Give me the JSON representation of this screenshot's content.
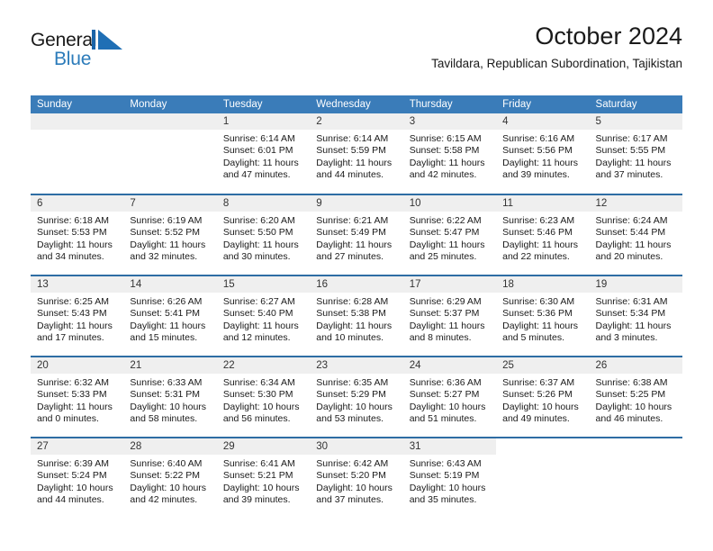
{
  "brand": {
    "name_part1": "General",
    "name_part2": "Blue",
    "mark": "triangle-logo"
  },
  "header": {
    "title": "October 2024",
    "subtitle": "Tavildara, Republican Subordination, Tajikistan"
  },
  "colors": {
    "header_blue": "#3a7cb9",
    "row_border_blue": "#2e6da4",
    "daynum_strip": "#efefef",
    "brand_blue": "#2b7bba"
  },
  "weekday_headers": [
    "Sunday",
    "Monday",
    "Tuesday",
    "Wednesday",
    "Thursday",
    "Friday",
    "Saturday"
  ],
  "weeks": [
    [
      {
        "day": "",
        "empty": true
      },
      {
        "day": "",
        "empty": true
      },
      {
        "day": "1",
        "sunrise": "Sunrise: 6:14 AM",
        "sunset": "Sunset: 6:01 PM",
        "daylight1": "Daylight: 11 hours",
        "daylight2": "and 47 minutes."
      },
      {
        "day": "2",
        "sunrise": "Sunrise: 6:14 AM",
        "sunset": "Sunset: 5:59 PM",
        "daylight1": "Daylight: 11 hours",
        "daylight2": "and 44 minutes."
      },
      {
        "day": "3",
        "sunrise": "Sunrise: 6:15 AM",
        "sunset": "Sunset: 5:58 PM",
        "daylight1": "Daylight: 11 hours",
        "daylight2": "and 42 minutes."
      },
      {
        "day": "4",
        "sunrise": "Sunrise: 6:16 AM",
        "sunset": "Sunset: 5:56 PM",
        "daylight1": "Daylight: 11 hours",
        "daylight2": "and 39 minutes."
      },
      {
        "day": "5",
        "sunrise": "Sunrise: 6:17 AM",
        "sunset": "Sunset: 5:55 PM",
        "daylight1": "Daylight: 11 hours",
        "daylight2": "and 37 minutes."
      }
    ],
    [
      {
        "day": "6",
        "sunrise": "Sunrise: 6:18 AM",
        "sunset": "Sunset: 5:53 PM",
        "daylight1": "Daylight: 11 hours",
        "daylight2": "and 34 minutes."
      },
      {
        "day": "7",
        "sunrise": "Sunrise: 6:19 AM",
        "sunset": "Sunset: 5:52 PM",
        "daylight1": "Daylight: 11 hours",
        "daylight2": "and 32 minutes."
      },
      {
        "day": "8",
        "sunrise": "Sunrise: 6:20 AM",
        "sunset": "Sunset: 5:50 PM",
        "daylight1": "Daylight: 11 hours",
        "daylight2": "and 30 minutes."
      },
      {
        "day": "9",
        "sunrise": "Sunrise: 6:21 AM",
        "sunset": "Sunset: 5:49 PM",
        "daylight1": "Daylight: 11 hours",
        "daylight2": "and 27 minutes."
      },
      {
        "day": "10",
        "sunrise": "Sunrise: 6:22 AM",
        "sunset": "Sunset: 5:47 PM",
        "daylight1": "Daylight: 11 hours",
        "daylight2": "and 25 minutes."
      },
      {
        "day": "11",
        "sunrise": "Sunrise: 6:23 AM",
        "sunset": "Sunset: 5:46 PM",
        "daylight1": "Daylight: 11 hours",
        "daylight2": "and 22 minutes."
      },
      {
        "day": "12",
        "sunrise": "Sunrise: 6:24 AM",
        "sunset": "Sunset: 5:44 PM",
        "daylight1": "Daylight: 11 hours",
        "daylight2": "and 20 minutes."
      }
    ],
    [
      {
        "day": "13",
        "sunrise": "Sunrise: 6:25 AM",
        "sunset": "Sunset: 5:43 PM",
        "daylight1": "Daylight: 11 hours",
        "daylight2": "and 17 minutes."
      },
      {
        "day": "14",
        "sunrise": "Sunrise: 6:26 AM",
        "sunset": "Sunset: 5:41 PM",
        "daylight1": "Daylight: 11 hours",
        "daylight2": "and 15 minutes."
      },
      {
        "day": "15",
        "sunrise": "Sunrise: 6:27 AM",
        "sunset": "Sunset: 5:40 PM",
        "daylight1": "Daylight: 11 hours",
        "daylight2": "and 12 minutes."
      },
      {
        "day": "16",
        "sunrise": "Sunrise: 6:28 AM",
        "sunset": "Sunset: 5:38 PM",
        "daylight1": "Daylight: 11 hours",
        "daylight2": "and 10 minutes."
      },
      {
        "day": "17",
        "sunrise": "Sunrise: 6:29 AM",
        "sunset": "Sunset: 5:37 PM",
        "daylight1": "Daylight: 11 hours",
        "daylight2": "and 8 minutes."
      },
      {
        "day": "18",
        "sunrise": "Sunrise: 6:30 AM",
        "sunset": "Sunset: 5:36 PM",
        "daylight1": "Daylight: 11 hours",
        "daylight2": "and 5 minutes."
      },
      {
        "day": "19",
        "sunrise": "Sunrise: 6:31 AM",
        "sunset": "Sunset: 5:34 PM",
        "daylight1": "Daylight: 11 hours",
        "daylight2": "and 3 minutes."
      }
    ],
    [
      {
        "day": "20",
        "sunrise": "Sunrise: 6:32 AM",
        "sunset": "Sunset: 5:33 PM",
        "daylight1": "Daylight: 11 hours",
        "daylight2": "and 0 minutes."
      },
      {
        "day": "21",
        "sunrise": "Sunrise: 6:33 AM",
        "sunset": "Sunset: 5:31 PM",
        "daylight1": "Daylight: 10 hours",
        "daylight2": "and 58 minutes."
      },
      {
        "day": "22",
        "sunrise": "Sunrise: 6:34 AM",
        "sunset": "Sunset: 5:30 PM",
        "daylight1": "Daylight: 10 hours",
        "daylight2": "and 56 minutes."
      },
      {
        "day": "23",
        "sunrise": "Sunrise: 6:35 AM",
        "sunset": "Sunset: 5:29 PM",
        "daylight1": "Daylight: 10 hours",
        "daylight2": "and 53 minutes."
      },
      {
        "day": "24",
        "sunrise": "Sunrise: 6:36 AM",
        "sunset": "Sunset: 5:27 PM",
        "daylight1": "Daylight: 10 hours",
        "daylight2": "and 51 minutes."
      },
      {
        "day": "25",
        "sunrise": "Sunrise: 6:37 AM",
        "sunset": "Sunset: 5:26 PM",
        "daylight1": "Daylight: 10 hours",
        "daylight2": "and 49 minutes."
      },
      {
        "day": "26",
        "sunrise": "Sunrise: 6:38 AM",
        "sunset": "Sunset: 5:25 PM",
        "daylight1": "Daylight: 10 hours",
        "daylight2": "and 46 minutes."
      }
    ],
    [
      {
        "day": "27",
        "sunrise": "Sunrise: 6:39 AM",
        "sunset": "Sunset: 5:24 PM",
        "daylight1": "Daylight: 10 hours",
        "daylight2": "and 44 minutes."
      },
      {
        "day": "28",
        "sunrise": "Sunrise: 6:40 AM",
        "sunset": "Sunset: 5:22 PM",
        "daylight1": "Daylight: 10 hours",
        "daylight2": "and 42 minutes."
      },
      {
        "day": "29",
        "sunrise": "Sunrise: 6:41 AM",
        "sunset": "Sunset: 5:21 PM",
        "daylight1": "Daylight: 10 hours",
        "daylight2": "and 39 minutes."
      },
      {
        "day": "30",
        "sunrise": "Sunrise: 6:42 AM",
        "sunset": "Sunset: 5:20 PM",
        "daylight1": "Daylight: 10 hours",
        "daylight2": "and 37 minutes."
      },
      {
        "day": "31",
        "sunrise": "Sunrise: 6:43 AM",
        "sunset": "Sunset: 5:19 PM",
        "daylight1": "Daylight: 10 hours",
        "daylight2": "and 35 minutes."
      },
      {
        "day": "",
        "blank": true
      },
      {
        "day": "",
        "blank": true
      }
    ]
  ]
}
